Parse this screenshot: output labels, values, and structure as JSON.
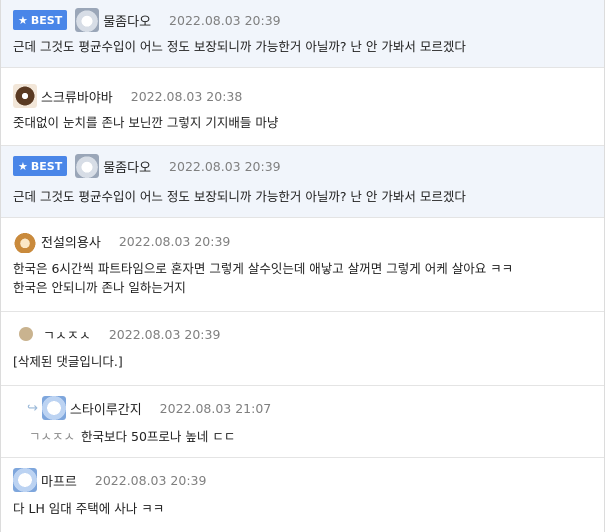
{
  "badge_label": "BEST",
  "comments": [
    {
      "author": "물좀다오",
      "avatar": "cat-icon",
      "date": "2022.08.03 20:39",
      "best": true,
      "lines": [
        "근데 그것도 평균수입이 어느 정도 보장되니까 가능한거 아닐까? 난 안 가봐서 모르겠다"
      ]
    },
    {
      "author": "스크류바야바",
      "avatar": "dog-icon",
      "date": "2022.08.03 20:38",
      "best": false,
      "lines": [
        "줏대없이 눈치를 존나 보닌깐 그렇지 기지배들 마냥"
      ]
    },
    {
      "author": "물좀다오",
      "avatar": "cat-icon",
      "date": "2022.08.03 20:39",
      "best": true,
      "lines": [
        "근데 그것도 평균수입이 어느 정도 보장되니까 가능한거 아닐까? 난 안 가봐서 모르겠다"
      ]
    },
    {
      "author": "전설의용사",
      "avatar": "fox-icon",
      "date": "2022.08.03 20:39",
      "best": false,
      "lines": [
        "한국은 6시간씩 파트타임으로 혼자면 그렇게 살수잇는데 애낳고 살꺼면 그렇게 어케 살아요 ㅋㅋ",
        "한국은 안되니까 존나 일하는거지"
      ]
    },
    {
      "author": "ㄱㅅㅈㅅ",
      "avatar": "dot-icon",
      "date": "2022.08.03 20:39",
      "best": false,
      "lines": [
        "[삭제된 댓글입니다.]"
      ]
    },
    {
      "author": "스타이루간지",
      "avatar": "ghost-icon",
      "date": "2022.08.03 21:07",
      "best": false,
      "reply": true,
      "reply_to": "ㄱㅅㅈㅅ",
      "lines": [
        "한국보다 50프로나 높네 ㄷㄷ"
      ]
    },
    {
      "author": "마프르",
      "avatar": "ghost-icon",
      "date": "2022.08.03 20:39",
      "best": false,
      "lines": [
        "다 LH 임대 주택에 사나 ㅋㅋ"
      ]
    }
  ]
}
